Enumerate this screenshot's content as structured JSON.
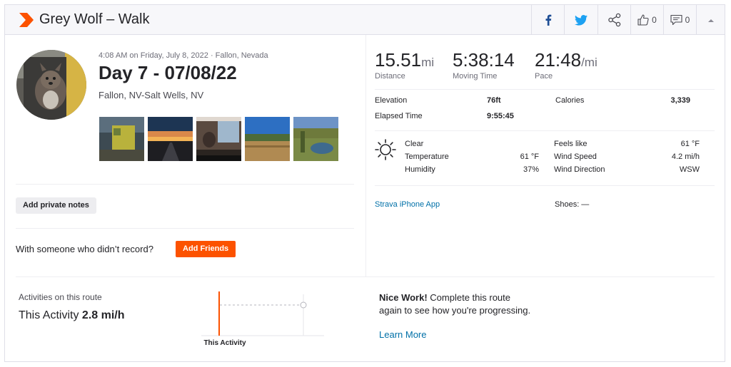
{
  "header": {
    "title": "Grey Wolf – Walk",
    "kudos_count": "0",
    "comment_count": "0"
  },
  "activity": {
    "datetime": "4:08 AM on Friday, July 8, 2022 · Fallon, Nevada",
    "title": "Day 7 - 07/08/22",
    "location": "Fallon, NV-Salt Wells, NV",
    "add_notes_label": "Add private notes",
    "with_someone_text": "With someone who didn’t record?",
    "add_friends_label": "Add Friends"
  },
  "stats": {
    "distance": {
      "value": "15.51",
      "unit": "mi",
      "label": "Distance"
    },
    "moving_time": {
      "value": "5:38:14",
      "label": "Moving Time"
    },
    "pace": {
      "value": "21:48",
      "unit": "/mi",
      "label": "Pace"
    }
  },
  "details": {
    "elevation_label": "Elevation",
    "elevation_value": "76ft",
    "calories_label": "Calories",
    "calories_value": "3,339",
    "elapsed_label": "Elapsed Time",
    "elapsed_value": "9:55:45"
  },
  "weather": {
    "condition": "Clear",
    "temperature_label": "Temperature",
    "temperature_value": "61 °F",
    "humidity_label": "Humidity",
    "humidity_value": "37%",
    "feels_like_label": "Feels like",
    "feels_like_value": "61 °F",
    "wind_speed_label": "Wind Speed",
    "wind_speed_value": "4.2 mi/h",
    "wind_direction_label": "Wind Direction",
    "wind_direction_value": "WSW",
    "icon": "sun-icon"
  },
  "device": {
    "app_label": "Strava iPhone App",
    "shoes_label": "Shoes: —"
  },
  "route": {
    "title": "Activities on this route",
    "this_activity_label": "This Activity",
    "this_activity_speed": "2.8 mi/h",
    "chart_label": "This Activity",
    "nice_bold": "Nice Work!",
    "nice_text": " Complete this route again to see how you're progressing.",
    "learn_more": "Learn More"
  },
  "colors": {
    "brand": "#fc5200",
    "link": "#0070a8",
    "facebook": "#1e4e95",
    "twitter": "#1da1f2"
  }
}
